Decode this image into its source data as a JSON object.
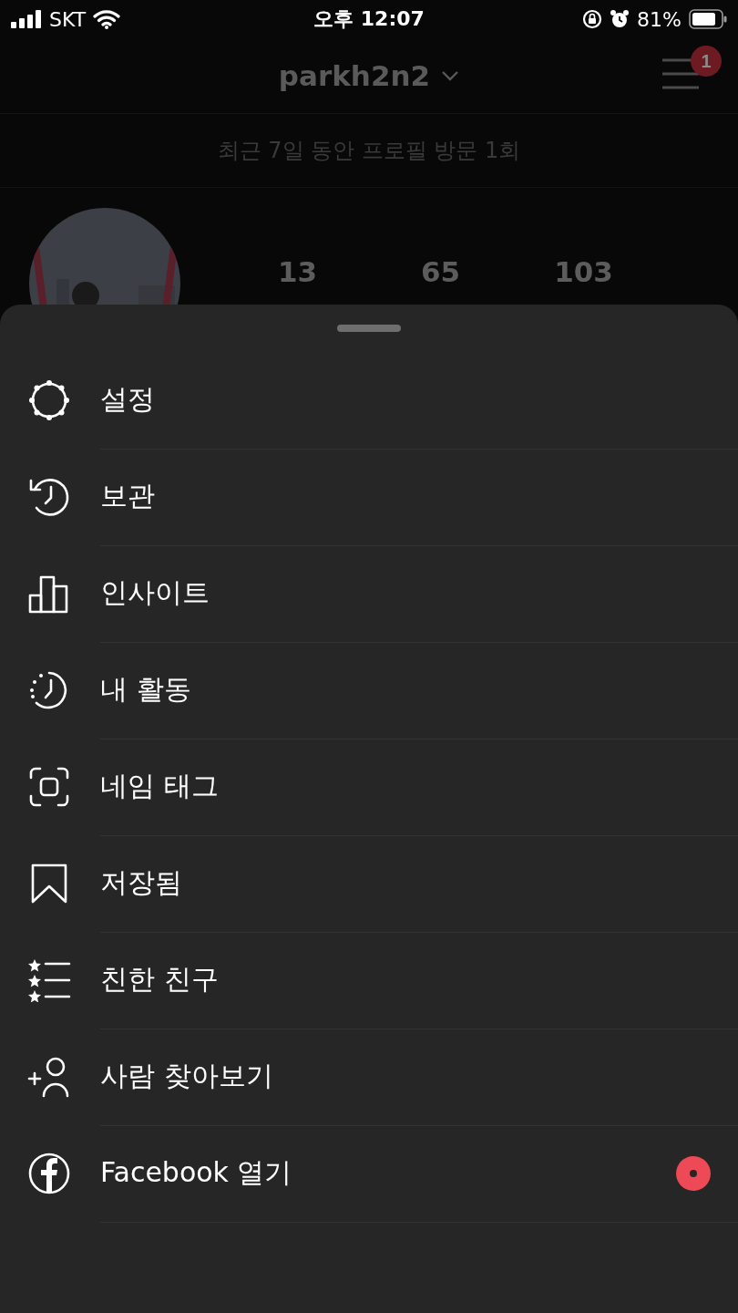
{
  "status_bar": {
    "carrier": "SKT",
    "time": "오후 12:07",
    "battery": "81%"
  },
  "header": {
    "username": "parkh2n2",
    "menu_badge": "1"
  },
  "visits": "최근 7일 동안 프로필 방문 1회",
  "profile": {
    "stats": [
      {
        "value": "13"
      },
      {
        "value": "65"
      },
      {
        "value": "103"
      }
    ]
  },
  "menu": [
    {
      "kind": "settings",
      "label": "설정",
      "notification_dot": false
    },
    {
      "kind": "archive",
      "label": "보관",
      "notification_dot": false
    },
    {
      "kind": "insights",
      "label": "인사이트",
      "notification_dot": false
    },
    {
      "kind": "activity",
      "label": "내 활동",
      "notification_dot": false
    },
    {
      "kind": "nametag",
      "label": "네임 태그",
      "notification_dot": false
    },
    {
      "kind": "saved",
      "label": "저장됨",
      "notification_dot": false
    },
    {
      "kind": "close_friends",
      "label": "친한 친구",
      "notification_dot": false
    },
    {
      "kind": "discover_people",
      "label": "사람 찾아보기",
      "notification_dot": false
    },
    {
      "kind": "facebook",
      "label": "Facebook 열기",
      "notification_dot": true
    }
  ]
}
